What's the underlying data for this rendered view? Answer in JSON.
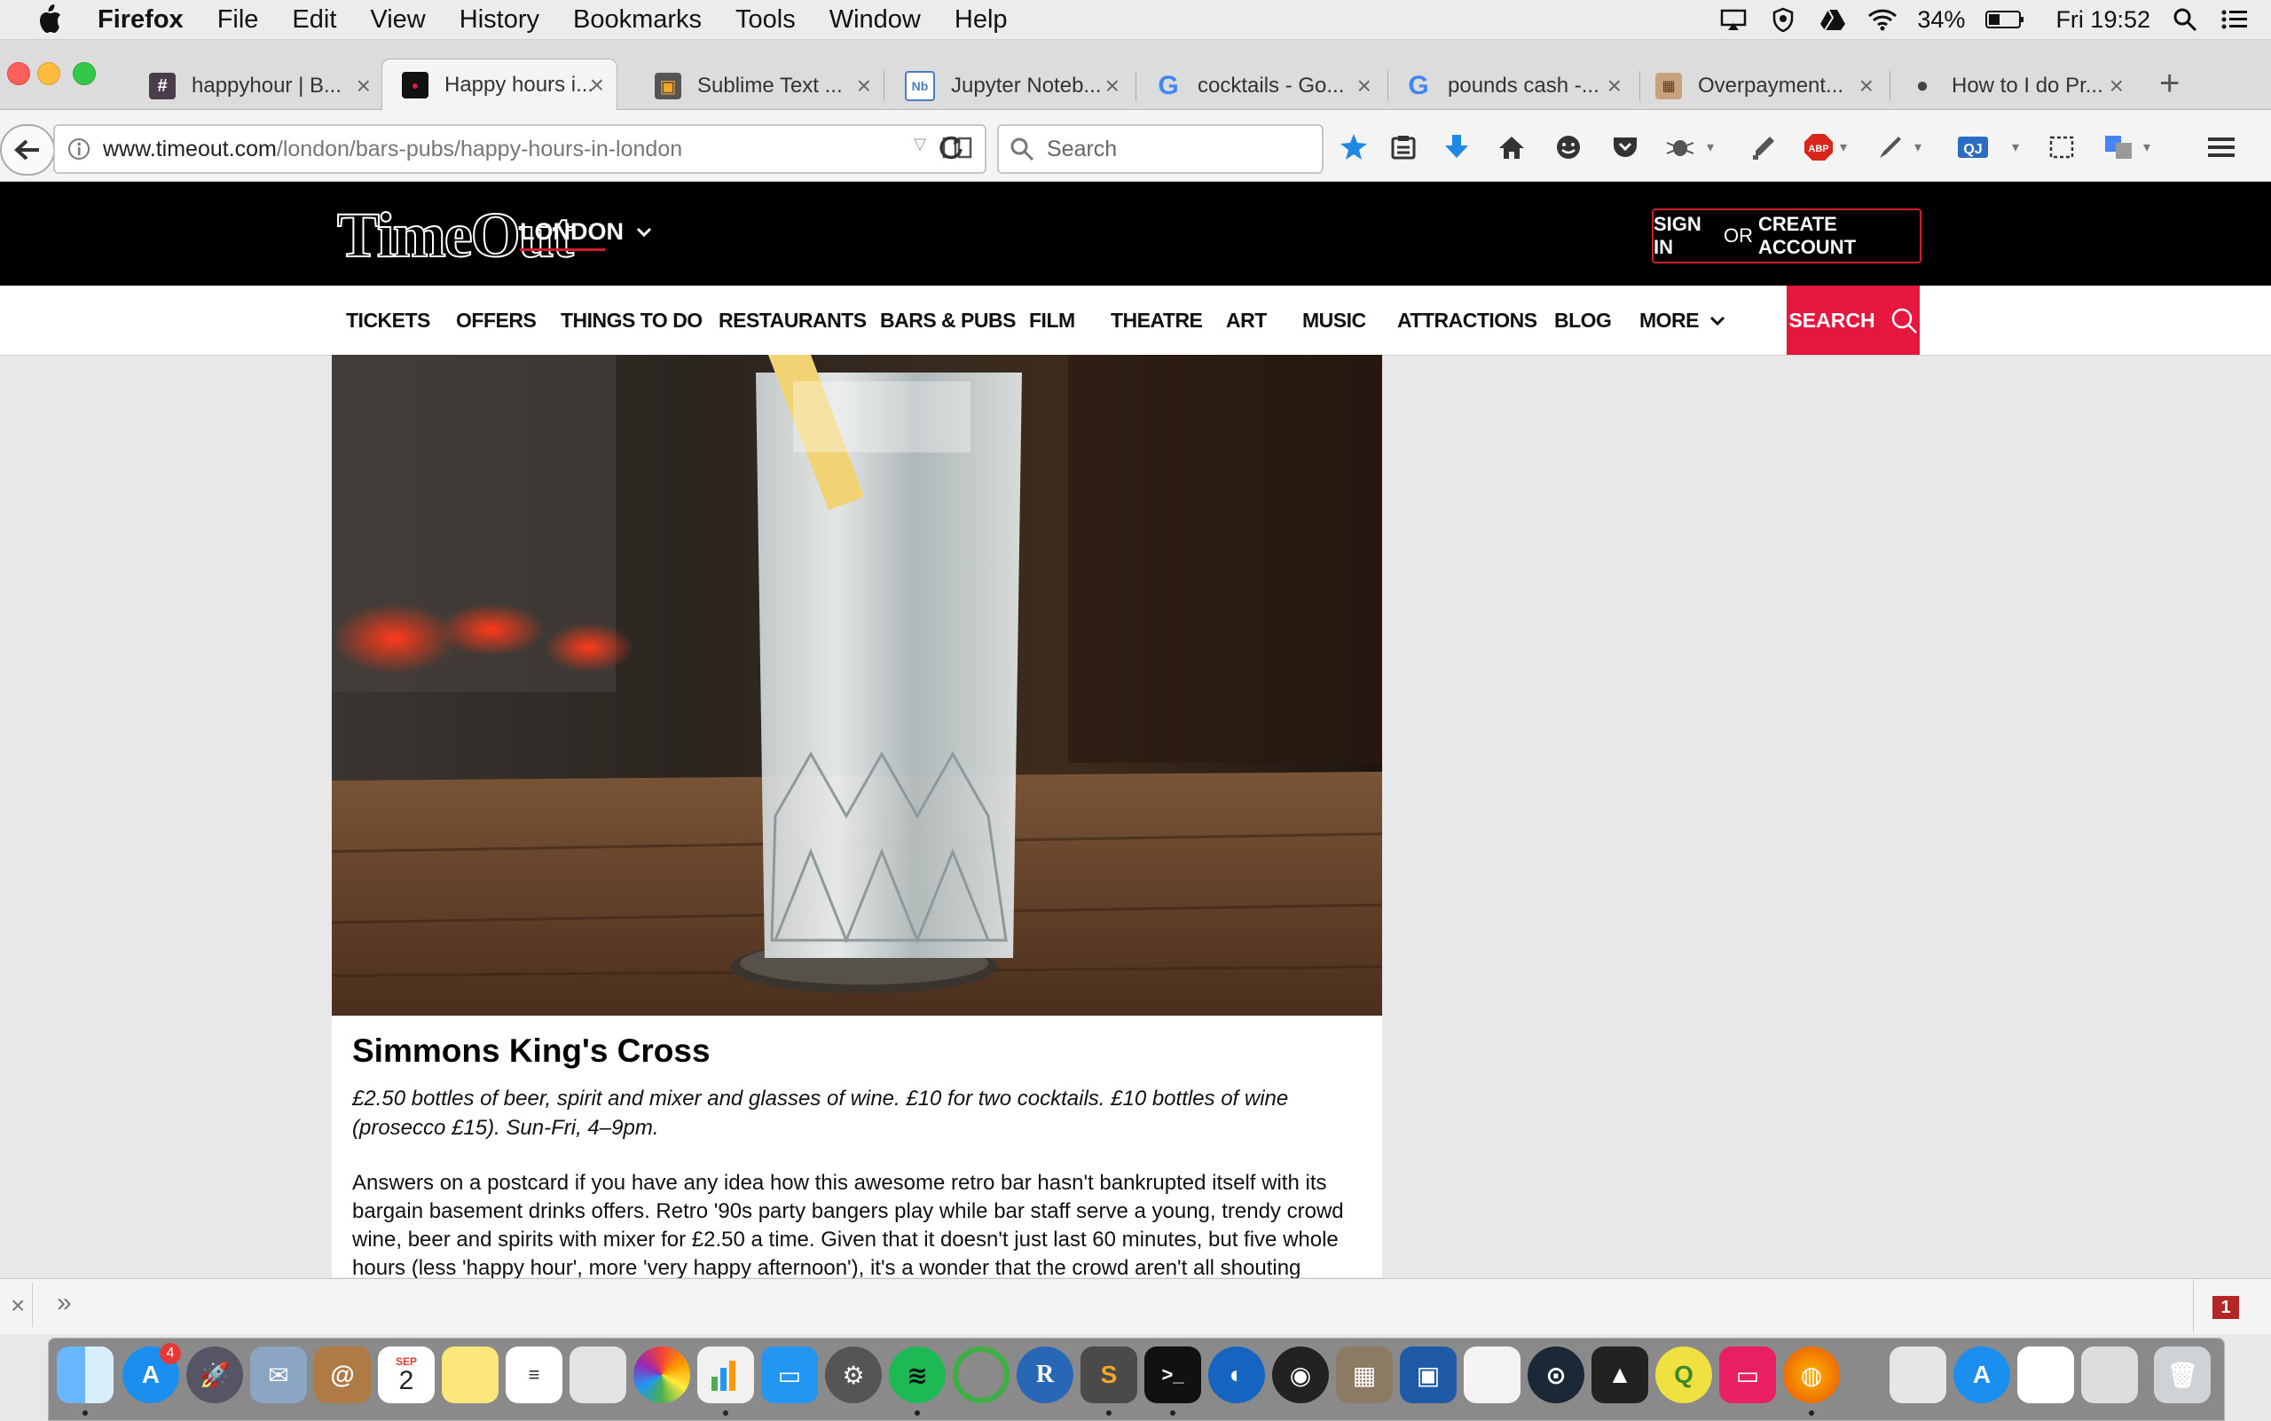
{
  "menubar": {
    "app": "Firefox",
    "items": [
      "File",
      "Edit",
      "View",
      "History",
      "Bookmarks",
      "Tools",
      "Window",
      "Help"
    ],
    "battery": "34%",
    "clock": "Fri 19:52"
  },
  "tabs": [
    {
      "title": "happyhour | B...",
      "favicon": "slack-icon"
    },
    {
      "title": "Happy hours i...",
      "favicon": "timeout-icon",
      "active": true
    },
    {
      "title": "Sublime Text ...",
      "favicon": "sublime-icon"
    },
    {
      "title": "Jupyter Noteb...",
      "favicon": "jupyter-icon"
    },
    {
      "title": "cocktails - Go...",
      "favicon": "google-icon"
    },
    {
      "title": "pounds cash -...",
      "favicon": "google-icon"
    },
    {
      "title": "Overpayment...",
      "favicon": "page-icon"
    },
    {
      "title": "How to I do Pr...",
      "favicon": "apple-icon"
    }
  ],
  "navbar": {
    "url_host": "www.timeout.com",
    "url_path": "/london/bars-pubs/happy-hours-in-london",
    "search_placeholder": "Search"
  },
  "site": {
    "logo": "TimeOut",
    "city": "LONDON",
    "signin": "SIGN IN",
    "or": "OR",
    "create": "CREATE ACCOUNT",
    "nav": [
      "TICKETS",
      "OFFERS",
      "THINGS TO DO",
      "RESTAURANTS",
      "BARS & PUBS",
      "FILM",
      "THEATRE",
      "ART",
      "MUSIC",
      "ATTRACTIONS",
      "BLOG",
      "MORE"
    ],
    "search": "SEARCH"
  },
  "article": {
    "title": "Simmons King's Cross",
    "offer": "£2.50 bottles of beer, spirit and mixer and glasses of wine. £10 for two cocktails. £10 bottles of wine (prosecco £15). Sun-Fri, 4–9pm.",
    "body": "Answers on a postcard if you have any idea how this awesome retro bar hasn't bankrupted itself with its bargain basement drinks offers. Retro '90s party bangers play while bar staff serve a young, trendy crowd wine, beer and spirits with mixer for £2.50 a time. Given that it doesn't just last 60 minutes, but five whole hours (less 'happy hour', more 'very happy afternoon'), it's a wonder that the crowd aren't all shouting abuse at"
  },
  "addonbar": {
    "badge": "1"
  },
  "dock": {
    "appstore_badge": "4",
    "calendar_month": "SEP",
    "calendar_day": "2"
  },
  "colors": {
    "timeout_red": "#e5173f",
    "link_blue": "#1e88e5"
  }
}
